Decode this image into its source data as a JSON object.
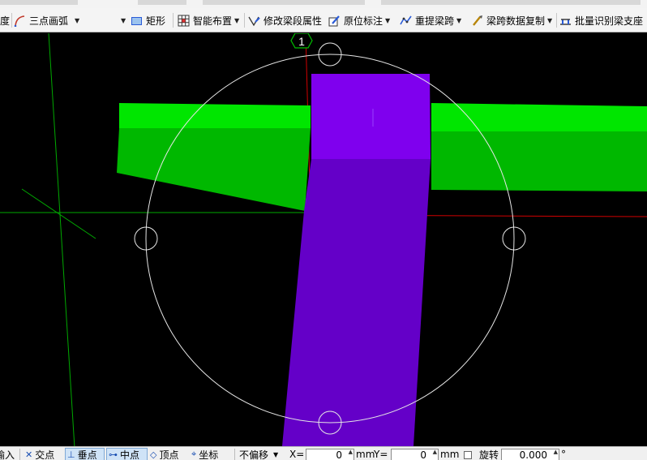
{
  "toolbar": {
    "edge_label": "度",
    "arc_label": "三点画弧",
    "rect_label": "矩形",
    "smart_layout_label": "智能布置",
    "modify_beam_label": "修改梁段属性",
    "inplace_label_label": "原位标注",
    "repick_span_label": "重提梁跨",
    "copy_span_label": "梁跨数据复制",
    "batch_identify_label": "批量识别梁支座"
  },
  "viewport": {
    "axis_marker": "1",
    "colors": {
      "beam_green_light": "#00e600",
      "beam_green_dark": "#00b800",
      "column_purple_top": "#7f00ee",
      "column_purple_side": "#6400c8",
      "grid_green": "#00b000",
      "axis_red": "#d00000"
    }
  },
  "statusbar": {
    "input_label": "输入",
    "intersection_label": "交点",
    "perpendicular_label": "垂点",
    "midpoint_label": "中点",
    "vertex_label": "顶点",
    "coordinate_label": "坐标",
    "offset_select": "不偏移",
    "x_label": "X=",
    "x_value": "0",
    "x_unit": "mm",
    "y_label": "Y=",
    "y_value": "0",
    "y_unit": "mm",
    "rotate_label": "旋转",
    "rotate_value": "0.000",
    "degree_symbol": "°"
  }
}
